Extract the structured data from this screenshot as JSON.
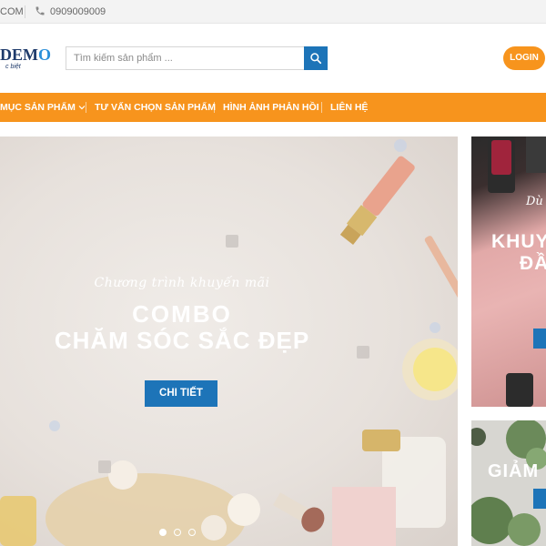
{
  "topbar": {
    "email_fragment": "COM",
    "phone": "0909009009"
  },
  "header": {
    "logo_text": "DEMO",
    "logo_tagline": "c biệt",
    "search_placeholder": "Tìm kiếm sản phẩm ...",
    "login_label": "LOGIN"
  },
  "nav": {
    "items": [
      {
        "label": "MỤC SẢN PHẨM"
      },
      {
        "label": "TƯ VẤN CHỌN SẢN PHẨM"
      },
      {
        "label": "HÌNH ẢNH PHẢN HỒI"
      },
      {
        "label": "LIÊN HỆ"
      }
    ]
  },
  "hero": {
    "script": "Chương trình khuyến mãi",
    "title_line1": "COMBO",
    "title_line2": "CHĂM SÓC SẮC ĐẸP",
    "cta_label": "CHI TIẾT",
    "slide_count": 3,
    "active_slide": 1
  },
  "side_banner_1": {
    "script": "Dù",
    "title_line1": "KHUY",
    "title_line2": "ĐẦ"
  },
  "side_banner_2": {
    "title": "GIẢM"
  },
  "colors": {
    "accent_orange": "#f7941d",
    "brand_blue": "#1d74b8",
    "logo_navy": "#1f3b6b",
    "topbar_bg": "#f3f3f3"
  }
}
